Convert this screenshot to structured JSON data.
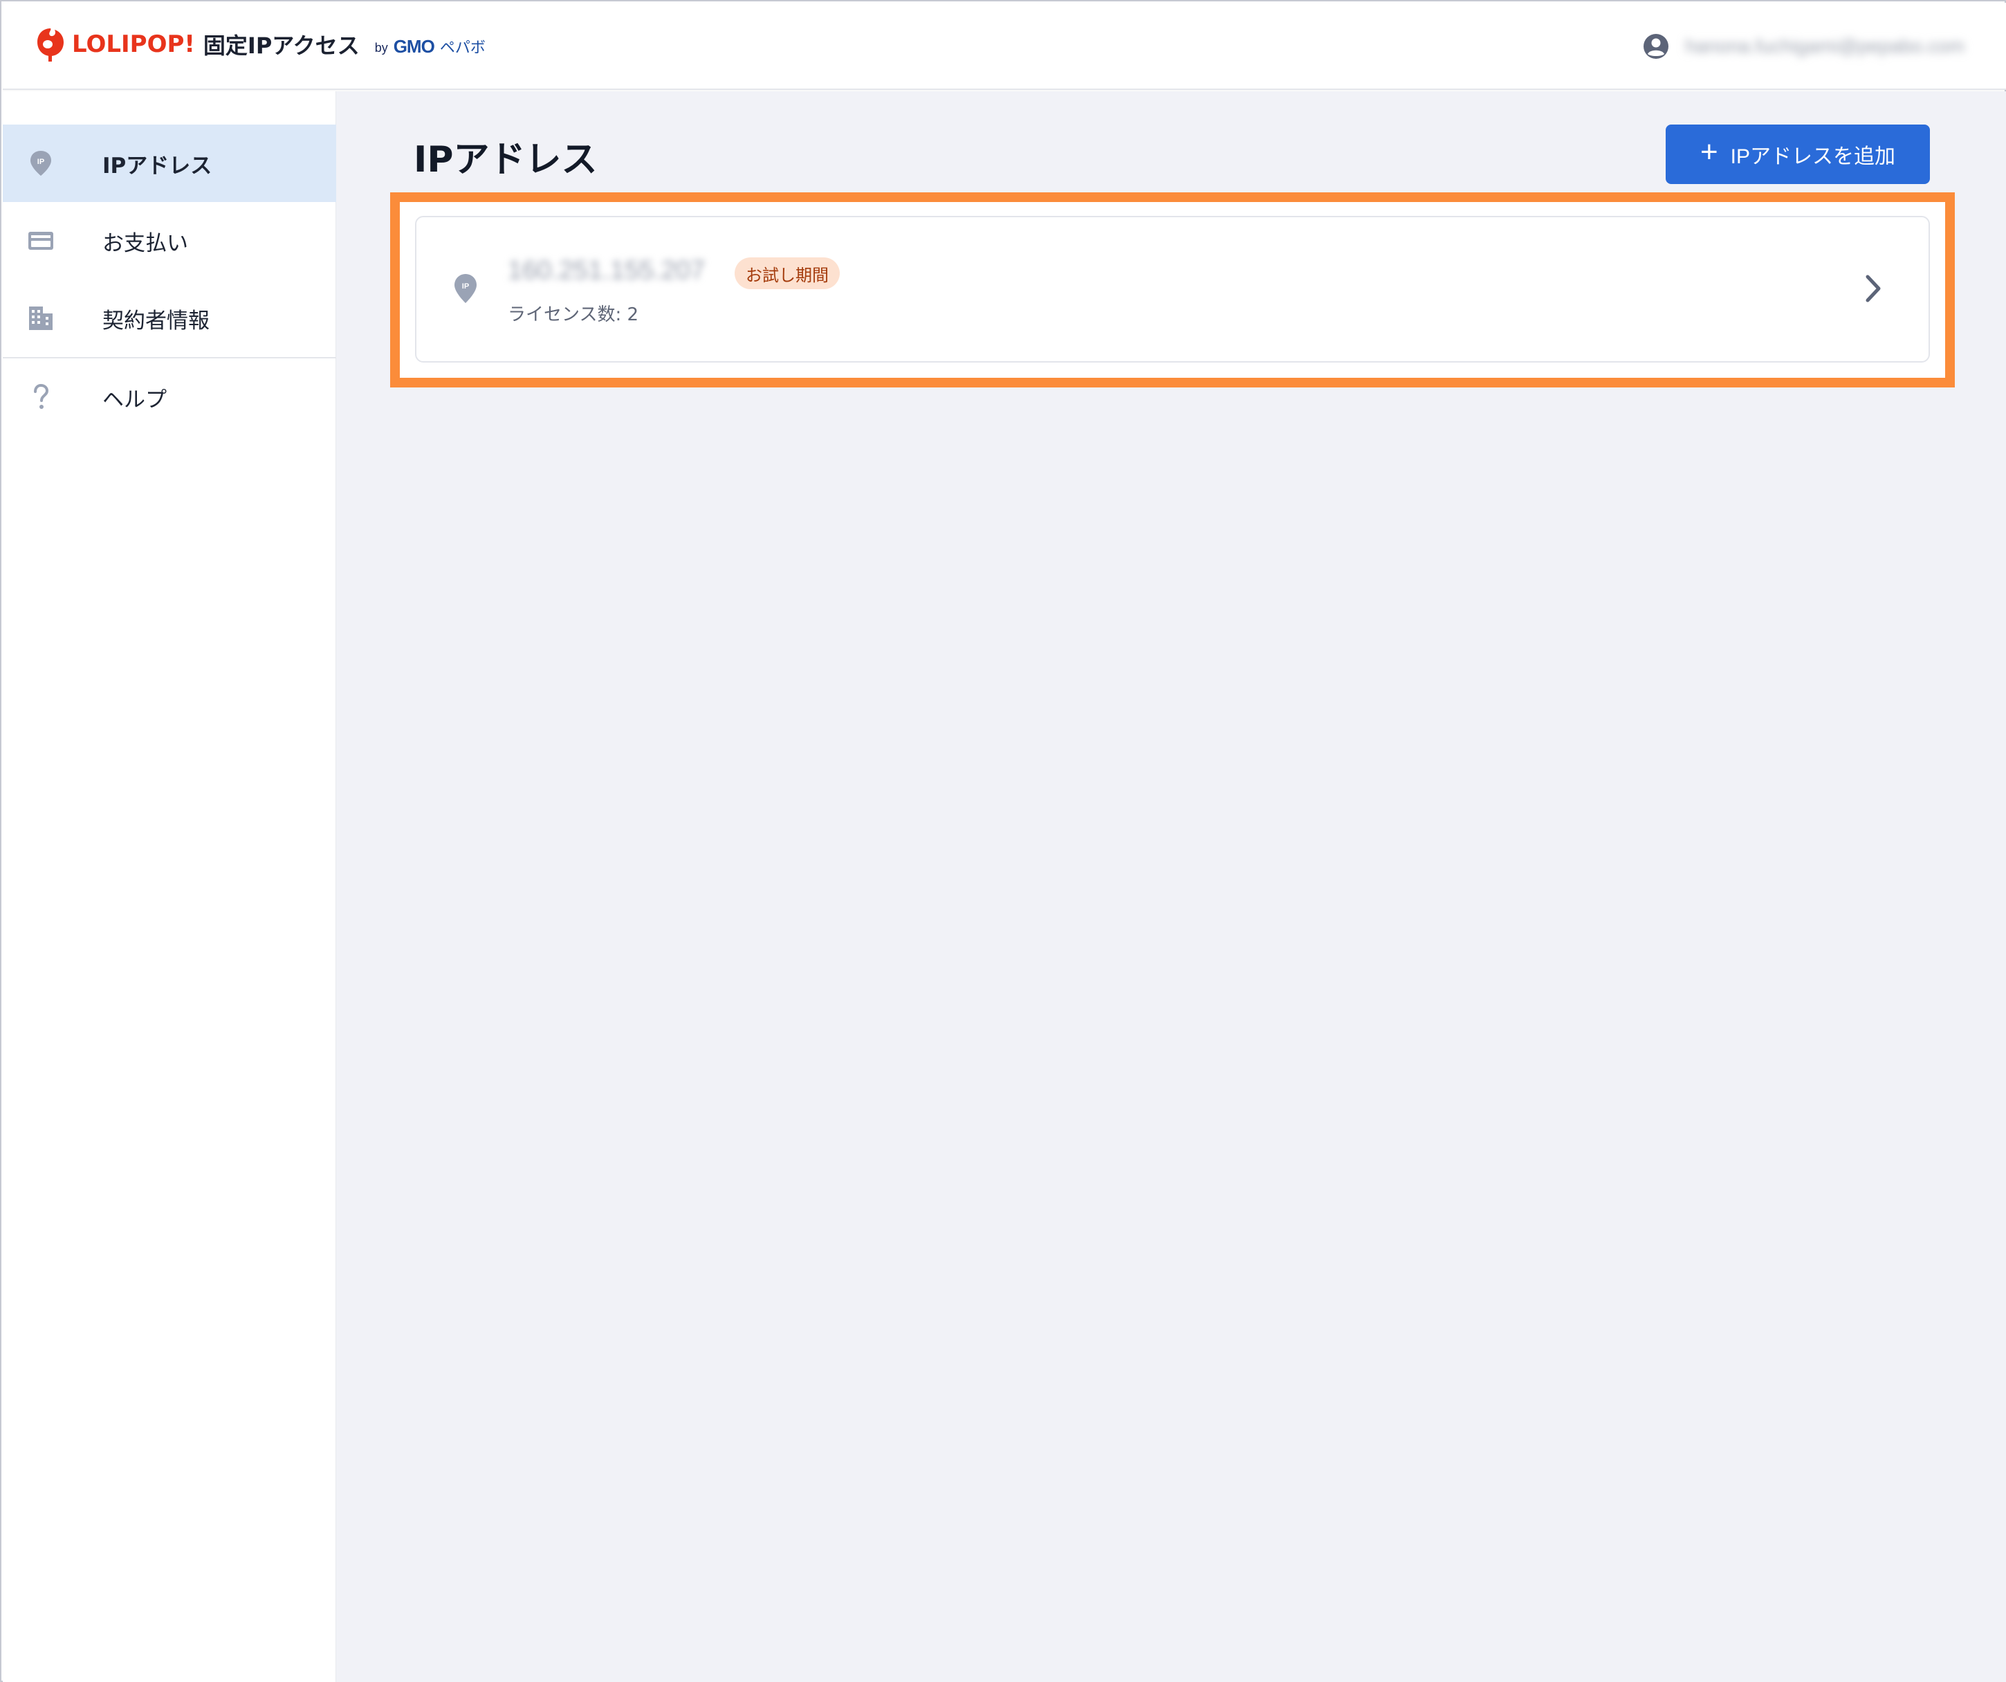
{
  "header": {
    "brand": "LOLIPOP!",
    "product": "固定IPアクセス",
    "by": "by",
    "company": "GMO",
    "company_suffix": "ペパボ",
    "user_email": "hanona.fuchigami@pepabo.com"
  },
  "sidebar": {
    "items": [
      {
        "label": "IPアドレス",
        "icon": "ip-pin-icon",
        "active": true
      },
      {
        "label": "お支払い",
        "icon": "credit-card-icon",
        "active": false
      },
      {
        "label": "契約者情報",
        "icon": "building-icon",
        "active": false
      },
      {
        "label": "ヘルプ",
        "icon": "question-icon",
        "active": false
      }
    ]
  },
  "main": {
    "title": "IPアドレス",
    "add_button_label": "IPアドレスを追加",
    "add_button_icon": "plus-icon",
    "ip_list": [
      {
        "ip": "160.251.155.207",
        "badge": "お試し期間",
        "license": "ライセンス数: 2"
      }
    ]
  },
  "colors": {
    "brand_red": "#e8341c",
    "primary_blue": "#2a6bd9",
    "sidebar_active": "#dbe8f8",
    "highlight_orange": "#fb8c3a",
    "badge_bg": "#fde1d0",
    "badge_text": "#a43b0c",
    "main_bg": "#f1f2f7"
  }
}
